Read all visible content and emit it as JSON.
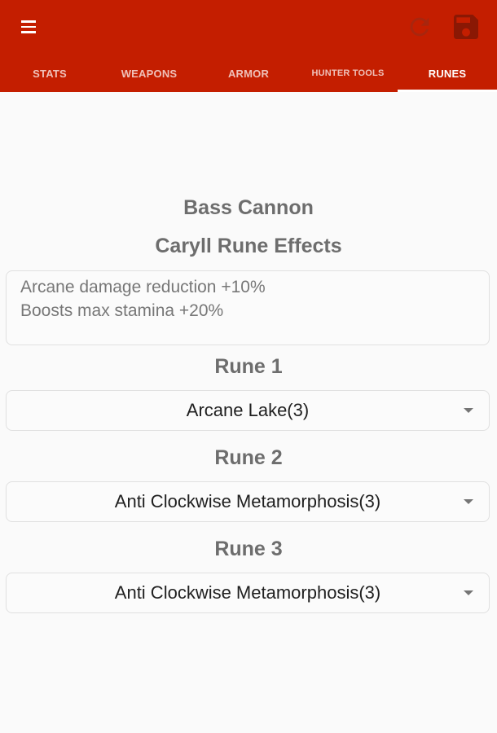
{
  "colors": {
    "toolbar": "#c41e00",
    "title_text": "#6d6d6d",
    "body_text": "#777777"
  },
  "toolbar": {
    "menu_icon": "hamburger-icon",
    "refresh_icon": "refresh-icon",
    "save_icon": "floppy-disk-icon"
  },
  "tabs": [
    {
      "label": "STATS"
    },
    {
      "label": "WEAPONS"
    },
    {
      "label": "ARMOR"
    },
    {
      "label": "HUNTER TOOLS"
    },
    {
      "label": "RUNES",
      "active": true
    }
  ],
  "main": {
    "weapon_name": "Bass Cannon",
    "effects_title": "Caryll Rune Effects",
    "effects": [
      "Arcane damage reduction +10%",
      "Boosts max stamina +20%"
    ],
    "runes": [
      {
        "label": "Rune 1",
        "value": "Arcane Lake(3)"
      },
      {
        "label": "Rune 2",
        "value": "Anti Clockwise Metamorphosis(3)"
      },
      {
        "label": "Rune 3",
        "value": "Anti Clockwise Metamorphosis(3)"
      }
    ]
  }
}
